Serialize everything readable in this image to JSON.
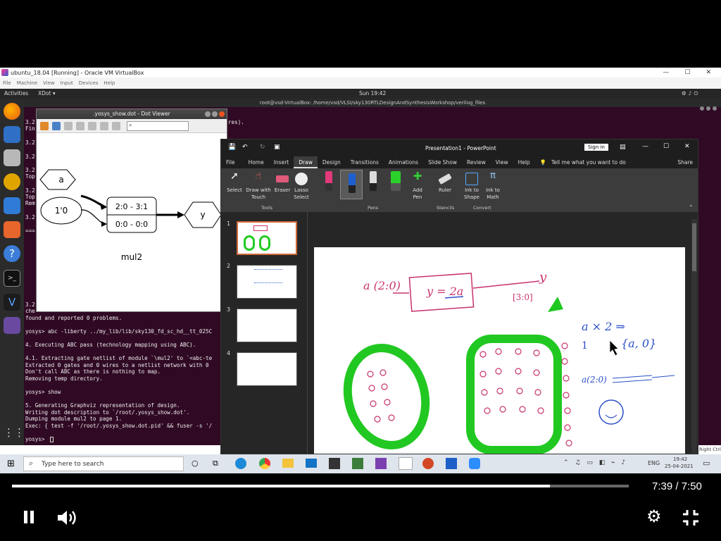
{
  "vbox": {
    "title": "ubuntu_18.04 [Running] - Oracle VM VirtualBox",
    "menu": [
      "File",
      "Machine",
      "View",
      "Input",
      "Devices",
      "Help"
    ]
  },
  "ubuntu": {
    "activities": "Activities",
    "app": "XDot ▾",
    "clock": "Sun 19:42"
  },
  "terminal": {
    "title": "root@vsd-VirtualBox: /home/vsd/VLSI/sky130RTLDesignAndSynthesisWorkshop/verilog_files",
    "lines": [
      "3.2",
      "Fin",
      "3.2",
      "3.2",
      "3.2",
      "Top",
      "3.2",
      "Top",
      "Rem",
      "3.2",
      "===",
      "3.2",
      "che",
      "found and reported 0 problems.",
      "yosys> abc -liberty ../my_lib/lib/sky130_fd_sc_hd__tt_025C",
      "4. Executing ABC pass (technology mapping using ABC).",
      "4.1. Extracting gate netlist of module `\\mul2' to `<abc-te",
      "Extracted 0 gates and 0 wires to a netlist network with 0",
      "Don't call ABC as there is nothing to map.",
      "Removing temp directory.",
      "yosys> show",
      "5. Generating Graphviz representation of design.",
      "Writing dot description to `/root/.yosys_show.dot'.",
      "Dumping module mul2 to page 1.",
      "Exec: { test -f '/root/.yosys_show.dot.pid' && fuser -s '/",
      "yosys> "
    ],
    "right_fragment": "res)."
  },
  "dotviewer": {
    "title": ".yosys_show.dot - Dot Viewer",
    "nodes": {
      "a": "a",
      "const": "1'0",
      "cell_top": "2:0 - 3:1",
      "cell_bottom": "0:0 - 0:0",
      "y": "y"
    },
    "module": "mul2"
  },
  "ppt": {
    "title": "Presentation1 - PowerPoint",
    "sign_in": "Sign in",
    "tabs": [
      "File",
      "Home",
      "Insert",
      "Draw",
      "Design",
      "Transitions",
      "Animations",
      "Slide Show",
      "Review",
      "View",
      "Help"
    ],
    "tell_me": "Tell me what you want to do",
    "share": "Share",
    "ribbon": {
      "select": "Select",
      "draw_touch": "Draw with Touch",
      "eraser": "Eraser",
      "lasso": "Lasso Select",
      "add_pen": "Add Pen",
      "ruler": "Ruler",
      "ink_shape": "Ink to Shape",
      "ink_math": "Ink to Math",
      "groups": {
        "tools": "Tools",
        "pens": "Pens",
        "stencils": "Stencils",
        "convert": "Convert"
      }
    },
    "slide_numbers": [
      "1",
      "2",
      "3",
      "4"
    ],
    "ink": {
      "input": "a (2:0)",
      "box": "y = 2a",
      "out": "y",
      "out_range": "[3:0]",
      "note": "a × 2 ⇒",
      "one": "1",
      "concat": "{a, 0}",
      "small": "a(2:0)"
    }
  },
  "taskbar": {
    "search": "Type here to search",
    "lang": "ENG",
    "time": "19:42",
    "date": "25-04-2021",
    "right_ctrl": "Right Ctrl"
  },
  "player": {
    "time": "7:39 / 7:50",
    "progress": 0.872
  }
}
